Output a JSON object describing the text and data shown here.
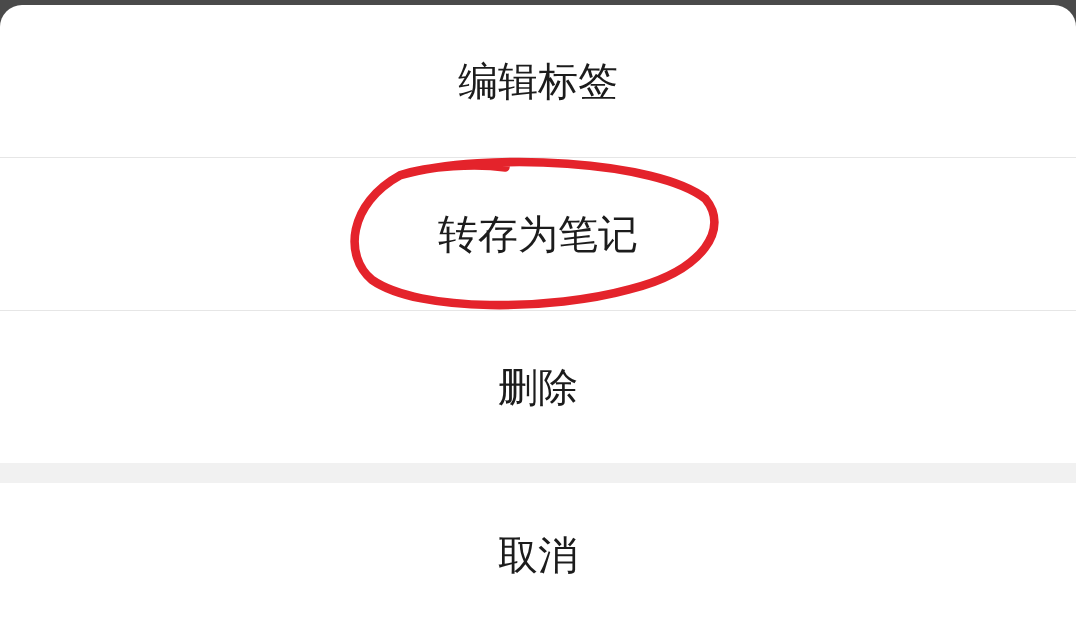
{
  "action_sheet": {
    "items": [
      {
        "label": "编辑标签",
        "highlighted": false
      },
      {
        "label": "转存为笔记",
        "highlighted": true
      },
      {
        "label": "删除",
        "highlighted": false
      }
    ],
    "cancel": {
      "label": "取消"
    }
  }
}
